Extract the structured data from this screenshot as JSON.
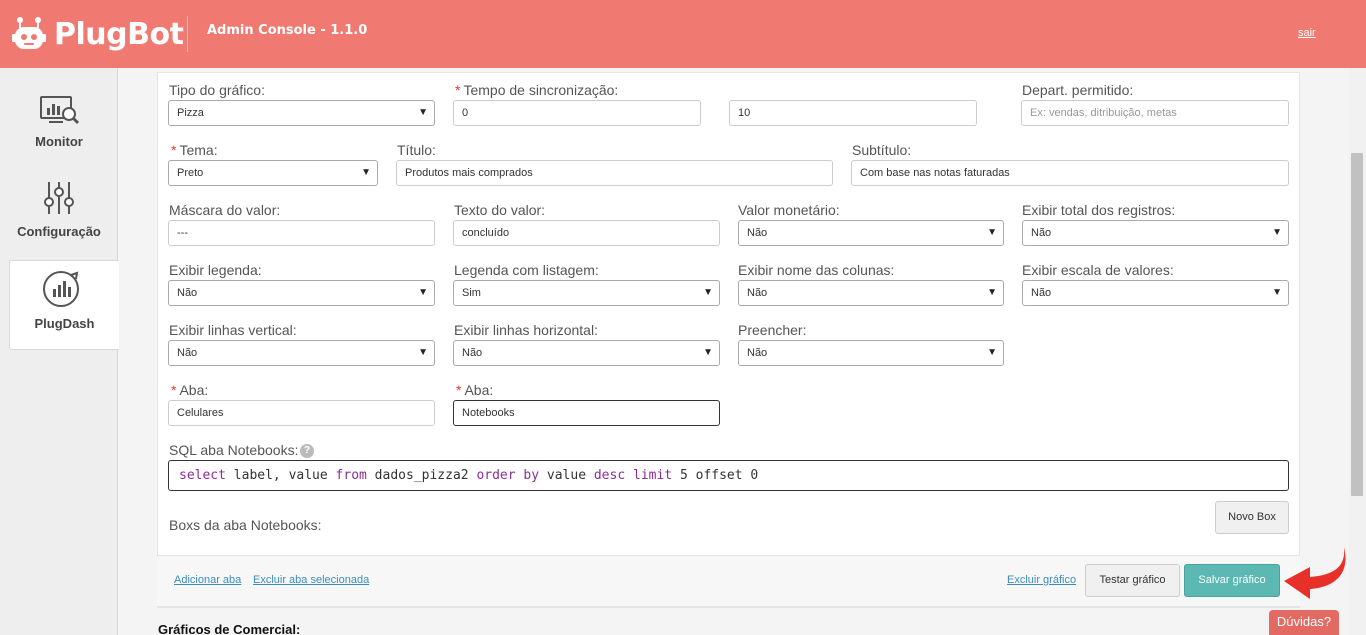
{
  "header": {
    "brand": "PlugBot",
    "title": "Admin Console - 1.1.0",
    "logout": "sair"
  },
  "sidebar": {
    "items": [
      {
        "label": "Monitor",
        "icon": "monitor-icon"
      },
      {
        "label": "Configuração",
        "icon": "sliders-icon"
      },
      {
        "label": "PlugDash",
        "icon": "dashboard-icon",
        "active": true
      }
    ]
  },
  "form": {
    "chart_type": {
      "label": "Tipo do gráfico:",
      "value": "Pizza"
    },
    "sync_time": {
      "label": "Tempo de sincronização:",
      "value": "0",
      "value2": "10"
    },
    "allowed_dept": {
      "label": "Depart. permitido:",
      "placeholder": "Ex: vendas, ditribuição, metas"
    },
    "theme": {
      "label": "Tema:",
      "value": "Preto"
    },
    "title": {
      "label": "Título:",
      "value": "Produtos mais comprados"
    },
    "subtitle": {
      "label": "Subtítulo:",
      "value": "Com base nas notas faturadas"
    },
    "value_mask": {
      "label": "Máscara do valor:",
      "value": "---"
    },
    "value_text": {
      "label": "Texto do valor:",
      "value": "concluído"
    },
    "monetary": {
      "label": "Valor monetário:",
      "value": "Não"
    },
    "show_total": {
      "label": "Exibir total dos registros:",
      "value": "Não"
    },
    "show_legend": {
      "label": "Exibir legenda:",
      "value": "Não"
    },
    "legend_list": {
      "label": "Legenda com listagem:",
      "value": "Sim"
    },
    "show_col_names": {
      "label": "Exibir nome das colunas:",
      "value": "Não"
    },
    "show_scale": {
      "label": "Exibir escala de valores:",
      "value": "Não"
    },
    "vertical_lines": {
      "label": "Exibir linhas vertical:",
      "value": "Não"
    },
    "horizontal_lines": {
      "label": "Exibir linhas horizontal:",
      "value": "Não"
    },
    "fill": {
      "label": "Preencher:",
      "value": "Não"
    },
    "tab1": {
      "label": "Aba:",
      "value": "Celulares"
    },
    "tab2": {
      "label": "Aba:",
      "value": "Notebooks"
    },
    "sql_label": "SQL aba Notebooks:",
    "sql": {
      "select": "select",
      "cols": " label, value ",
      "from": "from",
      "table": " dados_pizza2 ",
      "order": "order by",
      "ordcol": " value ",
      "desc": "desc",
      "limit": "limit",
      "limitval": " 5 ",
      "offset": "offset 0"
    },
    "boxes_label": "Boxs da aba Notebooks:",
    "new_box": "Novo Box"
  },
  "footer": {
    "add_tab": "Adicionar aba",
    "delete_tab": "Excluir aba selecionada",
    "delete_chart": "Excluir gráfico",
    "test_chart": "Testar gráfico",
    "save_chart": "Salvar gráfico"
  },
  "section_title": "Gráficos de Comercial:",
  "help_button": "Dúvidas?",
  "colors": {
    "header": "#f07a72",
    "primary_button": "#5cb8b2",
    "arrow": "#e8302a"
  }
}
